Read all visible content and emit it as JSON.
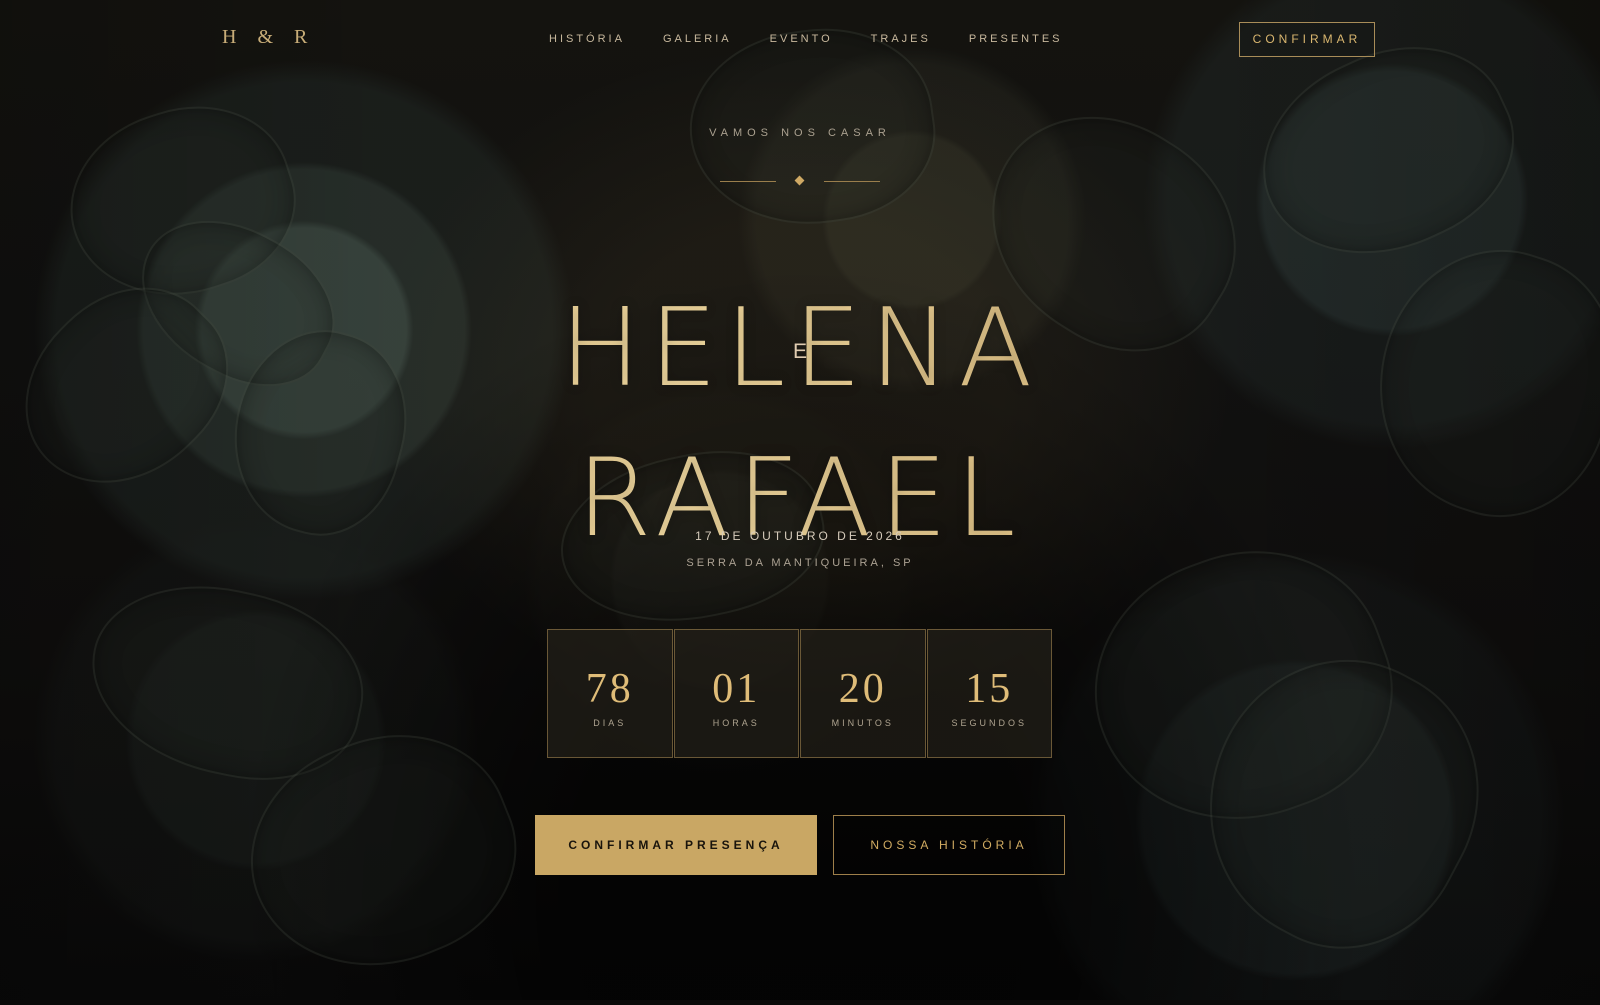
{
  "brand": {
    "monogram": "H & R"
  },
  "nav": {
    "items": [
      "HISTÓRIA",
      "GALERIA",
      "EVENTO",
      "TRAJES",
      "PRESENTES"
    ],
    "confirm": "CONFIRMAR"
  },
  "hero": {
    "eyebrow": "VAMOS NOS CASAR",
    "name_one": "HELENA",
    "conjunction": "E",
    "name_two": "RAFAEL",
    "date": "17 DE OUTUBRO DE 2026",
    "location": "SERRA DA MANTIQUEIRA, SP"
  },
  "countdown": [
    {
      "value": "78",
      "label": "DIAS"
    },
    {
      "value": "01",
      "label": "HORAS"
    },
    {
      "value": "20",
      "label": "MINUTOS"
    },
    {
      "value": "15",
      "label": "SEGUNDOS"
    }
  ],
  "actions": {
    "primary": "CONFIRMAR PRESENÇA",
    "secondary": "NOSSA HISTÓRIA"
  },
  "colors": {
    "accent": "#c9a764",
    "background": "#0b0a09",
    "muted": "#aca293"
  }
}
